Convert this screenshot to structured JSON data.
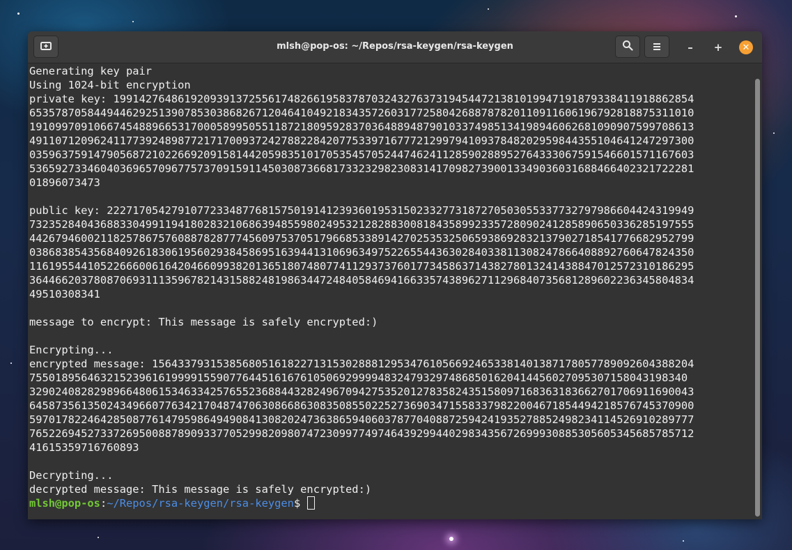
{
  "window": {
    "title": "mlsh@pop-os: ~/Repos/rsa-keygen/rsa-keygen",
    "new_tab_icon": "new-tab-icon",
    "search_icon": "search-icon",
    "menu_icon": "hamburger-menu-icon",
    "minimize": "–",
    "maximize": "+",
    "close": "✕"
  },
  "colors": {
    "terminal_bg": "#333333",
    "text": "#efefef",
    "prompt_user": "#73c936",
    "prompt_path": "#4d8ee6",
    "close_button": "#f7a033"
  },
  "terminal": {
    "lines": [
      "Generating key pair",
      "Using 1024-bit encryption",
      "private key: 19914276486192093913725561748266195837870324327637319454472138101994719187933841191886285​4",
      "6535787058449446292513907853038682671204641049218343572603177258042688787820110911606196792818875311010",
      "1910997091066745488966531700058995055118721809592837036488948790103374985134198946062681090907599708613",
      "4911071209624117739248987721717009372427882284207753397167772129979410937848202959844355104641247297300",
      "0359637591479056872102266920915814420598351017053545705244746241128590288952764333067591546601571167603",
      "5365927334604036965709677573709159114503087366817332329823083141709827390013349036031688466402321722281",
      "01896073473",
      "",
      "public key: 222717054279107723348776815750191412393601953150233277318727050305533773279798660442431994​9",
      "7323528404368833049911941802832106863948559802495321282883008184358992335728090241285890650336285197555",
      "4426794600211825786757608878287774560975370517966853389142702535325065938692832137902718541776682952799",
      "0386838543568409261830619560293845869516394413106963497522655443630284033811308247866408892760647824350",
      "1161955441052266600616420466099382013651807480774112937376017734586371438278013241438847012572310186295",
      "3644662037808706931113596782143158824819863447248405846941663357438962711296840735681289602236345804834",
      "49510308341",
      "",
      "message to encrypt: This message is safely encrypted:)",
      "",
      "Encrypting...",
      "encrypted message: 156433793153856805161822713153028881295347610566924653381401387178057789092604388204",
      "7550189564632152396161999915590776445161676105069299994832479329748685016204144560270953071580431983​40",
      "3290240828298966480615346334257655236884432824967094275352012783582435158097168363183662701706911690043",
      "6458735613502434966077634217048747063086686308350855022527369034715583379822004671854494218576745370900",
      "5970178224642850877614795986494908413082024736386594060378770408872594241935278852498234114526910289777",
      "7652269452733726950088789093377052998209807472309977497464392994402983435672699930885305605345685785712",
      "41615359716760893",
      "",
      "Decrypting...",
      "decrypted message: This message is safely encrypted:)"
    ],
    "prompt": {
      "user_host": "mlsh@pop-os",
      "separator": ":",
      "path": "~/Repos/rsa-keygen/rsa-keygen",
      "symbol": "$"
    }
  }
}
